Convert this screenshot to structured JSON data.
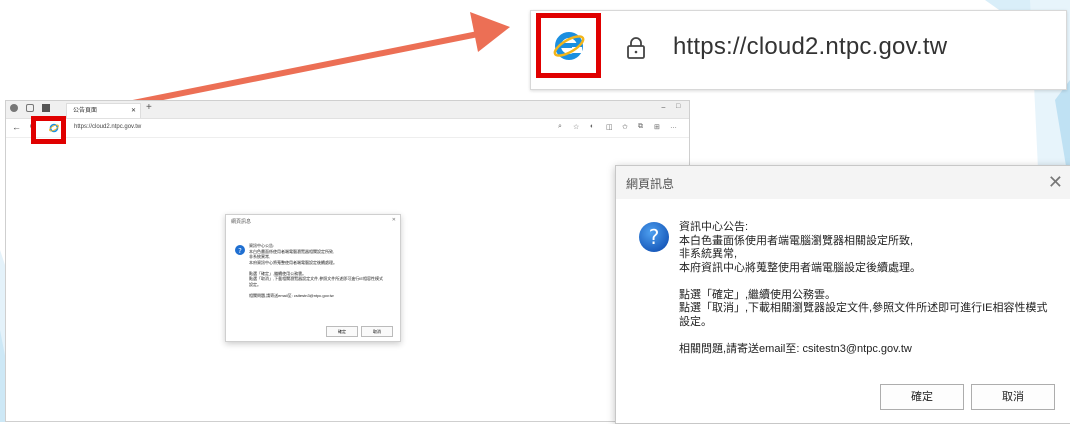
{
  "zoomed_address_bar": {
    "url": "https://cloud2.ntpc.gov.tw",
    "icon": "ie-icon",
    "lock_icon": "lock-icon"
  },
  "browser": {
    "tab_label": "公告頁面",
    "new_tab": "+",
    "url": "https://cloud2.ntpc.gov.tw",
    "nav": {
      "back": "←",
      "refresh": "C"
    },
    "toolbar_icons": [
      "zoom-icon",
      "favorite-star-icon",
      "tracking-icon",
      "split-screen-icon",
      "favorites-icon",
      "collections-icon",
      "extensions-icon",
      "more-icon"
    ],
    "window": {
      "minimize": "−",
      "maximize": "□"
    }
  },
  "dialog": {
    "title": "網頁訊息",
    "close": "✕",
    "lines": [
      "資訊中心公告:",
      "本白色畫面係使用者端電腦瀏覽器相關設定所致,",
      "非系統異常,",
      "本府資訊中心將蒐整使用者端電腦設定後續處理。",
      "",
      "點選「確定」,繼續使用公務雲。",
      "點選「取消」,下載相關瀏覽器設定文件,參照文件所述即可進行IE相容性模式",
      "設定。",
      "",
      "相關問題,請寄送email至: csitestn3@ntpc.gov.tw"
    ],
    "ok_label": "確定",
    "cancel_label": "取消"
  },
  "colors": {
    "highlight_red": "#e00000",
    "arrow": "#ec6f55",
    "question_icon": "#1f6fd1",
    "ie_blue": "#1b8fe0",
    "ie_gold": "#f2b51a",
    "deco_blue": "#cfe9f7"
  }
}
